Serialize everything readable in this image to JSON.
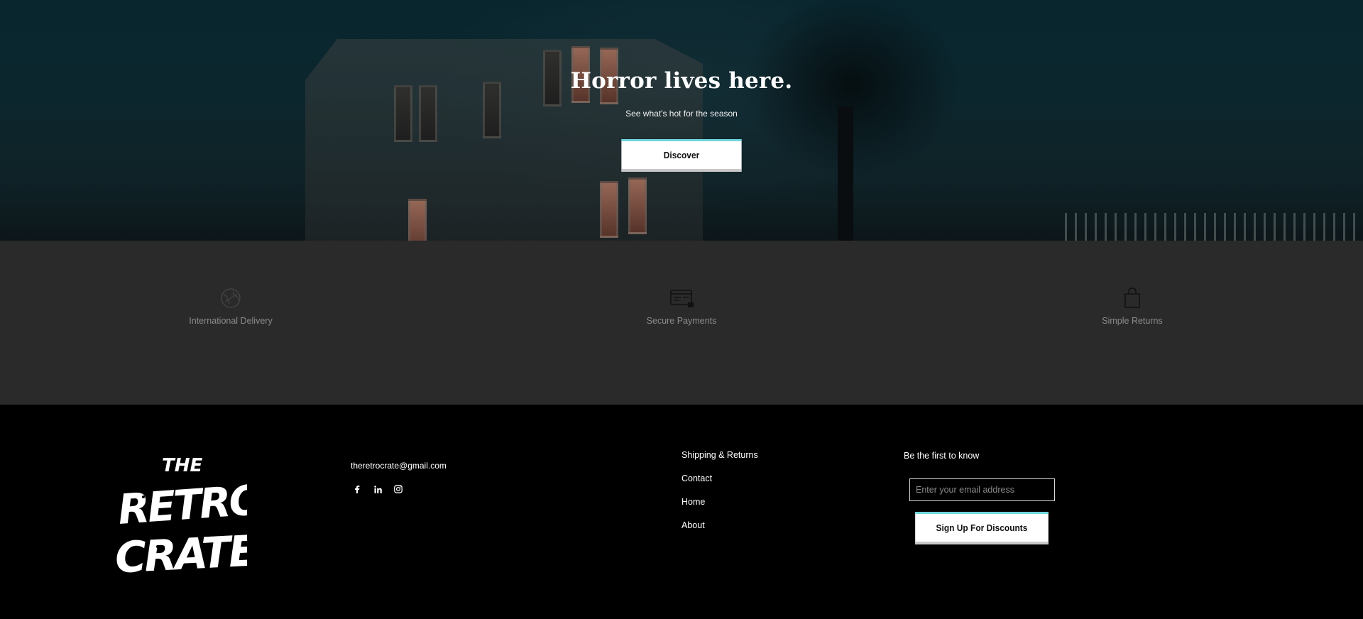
{
  "hero": {
    "title": "Horror lives here.",
    "subtitle": "See what's hot for the season",
    "button_label": "Discover"
  },
  "features": [
    {
      "label": "International Delivery",
      "icon": "globe-icon"
    },
    {
      "label": "Secure Payments",
      "icon": "credit-card-icon"
    },
    {
      "label": "Simple Returns",
      "icon": "shopping-bag-icon"
    }
  ],
  "footer": {
    "logo_alt": "The Retro Crate",
    "logo_lines": [
      "THE",
      "RETRO",
      "CRATE"
    ],
    "contact_email": "theretrocrate@gmail.com",
    "social": [
      {
        "name": "facebook",
        "icon": "facebook-icon"
      },
      {
        "name": "linkedin",
        "icon": "linkedin-icon"
      },
      {
        "name": "instagram",
        "icon": "instagram-icon"
      }
    ],
    "links": [
      "Shipping & Returns",
      "Contact",
      "Home",
      "About"
    ],
    "newsletter": {
      "title": "Be the first to know",
      "placeholder": "Enter your email address",
      "button_label": "Sign Up For Discounts"
    }
  },
  "colors": {
    "accent": "#6fd6dd",
    "features_bg": "#2a2a2a",
    "footer_bg": "#000000"
  }
}
